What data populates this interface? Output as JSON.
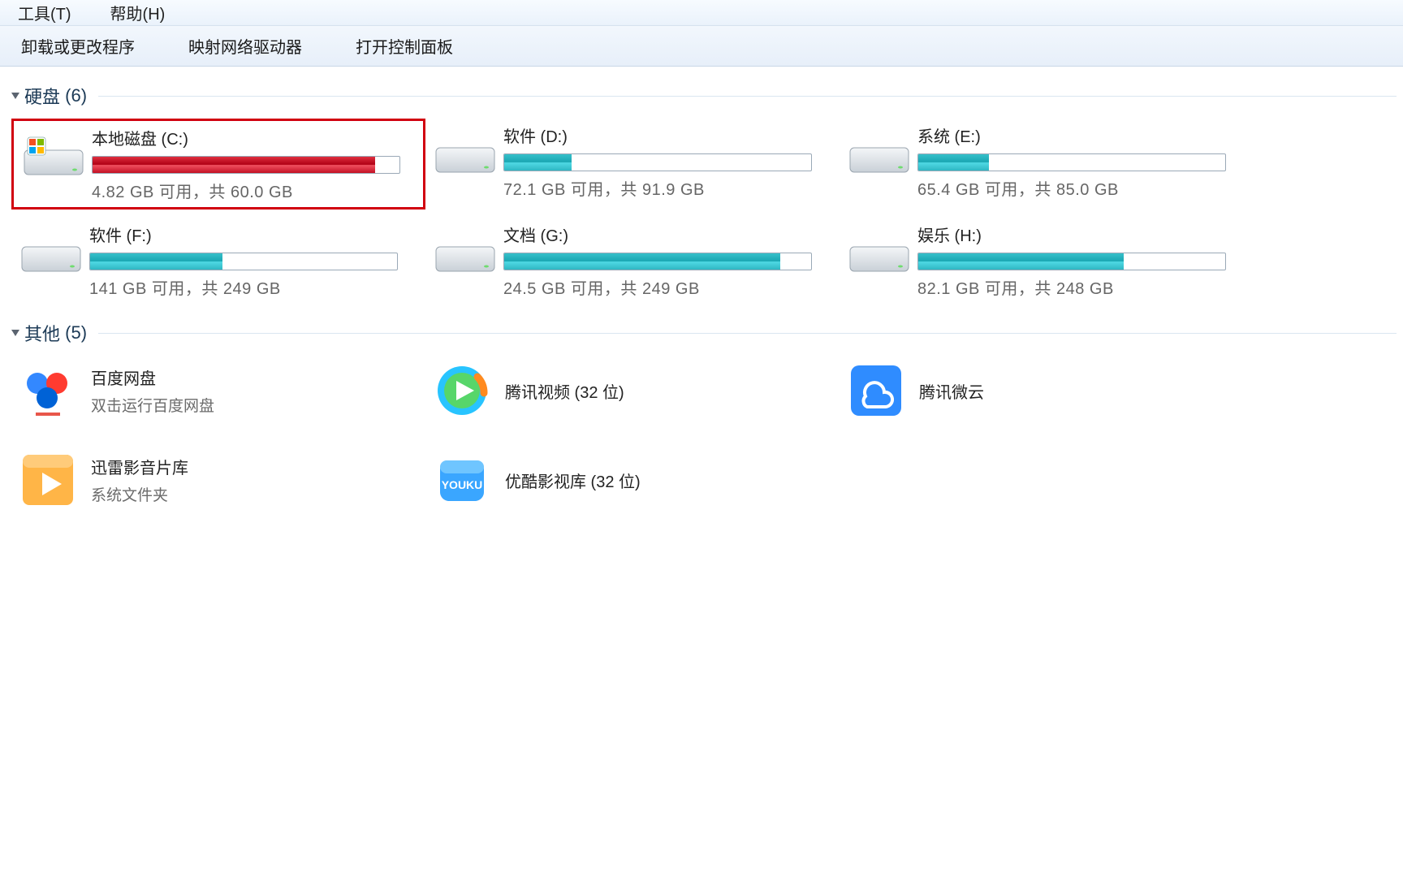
{
  "menubar": {
    "tools": "工具(T)",
    "help": "帮助(H)"
  },
  "toolbar": {
    "uninstall": "卸载或更改程序",
    "map_drive": "映射网络驱动器",
    "control_panel": "打开控制面板"
  },
  "groups": {
    "hdd": {
      "label": "硬盘",
      "count": "(6)"
    },
    "other": {
      "label": "其他",
      "count": "(5)"
    }
  },
  "drives": [
    {
      "label": "本地磁盘 (C:)",
      "stat": "4.82 GB 可用，共 60.0 GB",
      "fill_pct": 92,
      "low_space": true,
      "highlight": true,
      "os": true
    },
    {
      "label": "软件 (D:)",
      "stat": "72.1 GB 可用，共 91.9 GB",
      "fill_pct": 22,
      "low_space": false
    },
    {
      "label": "系统 (E:)",
      "stat": "65.4 GB 可用，共 85.0 GB",
      "fill_pct": 23,
      "low_space": false
    },
    {
      "label": "软件 (F:)",
      "stat": "141 GB 可用，共 249 GB",
      "fill_pct": 43,
      "low_space": false
    },
    {
      "label": "文档 (G:)",
      "stat": "24.5 GB 可用，共 249 GB",
      "fill_pct": 90,
      "low_space": false
    },
    {
      "label": "娱乐 (H:)",
      "stat": "82.1 GB 可用，共 248 GB",
      "fill_pct": 67,
      "low_space": false
    }
  ],
  "others": [
    {
      "title": "百度网盘",
      "sub": "双击运行百度网盘",
      "icon": "baidu"
    },
    {
      "title": "腾讯视频 (32 位)",
      "sub": "",
      "icon": "tencent-video"
    },
    {
      "title": "腾讯微云",
      "sub": "",
      "icon": "weiyun"
    },
    {
      "title": "迅雷影音片库",
      "sub": "系统文件夹",
      "icon": "xunlei"
    },
    {
      "title": "优酷影视库 (32 位)",
      "sub": "",
      "icon": "youku"
    }
  ]
}
